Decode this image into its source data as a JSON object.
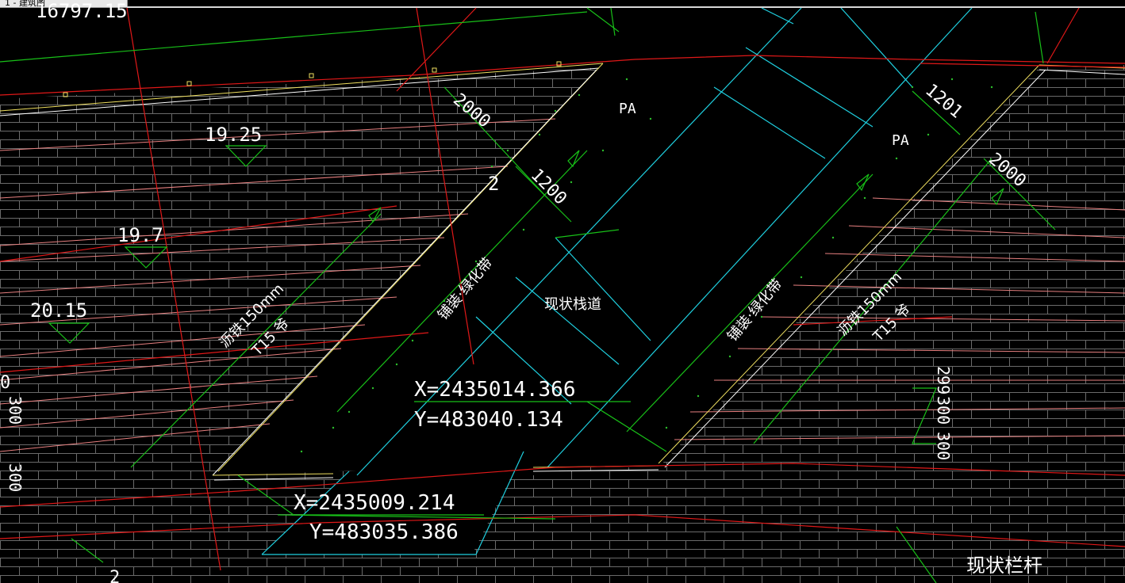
{
  "window": {
    "tab_label": "1 - 建筑图"
  },
  "colors": {
    "background": "#000000",
    "cyan": "#1fd0e0",
    "red": "#e01818",
    "green": "#18c018",
    "yellow": "#f0e060",
    "white": "#ffffff",
    "grey_hatch": "#707070"
  },
  "drawing": {
    "corner_value": "16797.15",
    "elevations": [
      "19.25",
      "19.7",
      "20.15"
    ],
    "area_labels": [
      "PA",
      "PA"
    ],
    "dimensions": [
      "2000",
      "1200",
      "1201",
      "2000"
    ],
    "small_mark": "2",
    "ramp_left": {
      "line1": "沥铁150mm",
      "line2": "T15 爷"
    },
    "walkway_left": "铺装·绿化带",
    "walkway_right": "铺装·绿化带",
    "ramp_right": {
      "line1": "沥铁150mm",
      "line2": "T15 爷"
    },
    "existing_path": "现状栈道",
    "existing_railing": "现状栏杆",
    "coordinate_a": {
      "x": "X=2435014.366",
      "y": "Y=483040.134"
    },
    "coordinate_b": {
      "x": "X=2435009.214",
      "y": "Y=483035.386"
    },
    "right_vertical_dims": [
      "299",
      "300",
      "300"
    ],
    "left_edge_dims": [
      "300",
      "300"
    ],
    "edge_fragments": [
      "0",
      "2"
    ]
  }
}
